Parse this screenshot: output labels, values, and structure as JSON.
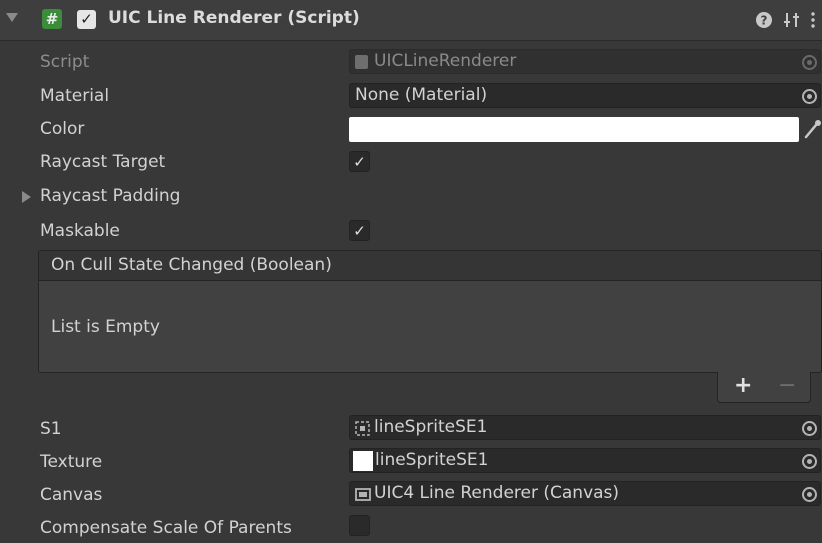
{
  "header": {
    "component_title": "UIC Line Renderer (Script)",
    "enabled_check": "✓",
    "script_icon_glyph": "#",
    "icons": [
      "help-icon",
      "presets-icon",
      "kebab-menu-icon"
    ]
  },
  "rows": {
    "script": {
      "label": "Script",
      "value": "UICLineRenderer"
    },
    "material": {
      "label": "Material",
      "value": "None (Material)"
    },
    "color": {
      "label": "Color",
      "value": "#ffffff"
    },
    "raycast_target": {
      "label": "Raycast Target",
      "check": "✓"
    },
    "raycast_padding": {
      "label": "Raycast Padding"
    },
    "maskable": {
      "label": "Maskable",
      "check": "✓"
    },
    "s1": {
      "label": "S1",
      "value": "lineSpriteSE1"
    },
    "texture": {
      "label": "Texture",
      "value": "lineSpriteSE1"
    },
    "canvas": {
      "label": "Canvas",
      "value": "UIC4 Line Renderer (Canvas)"
    },
    "compensate": {
      "label": "Compensate Scale Of Parents",
      "checked": false
    }
  },
  "event": {
    "title": "On Cull State Changed (Boolean)",
    "empty_text": "List is Empty",
    "add_label": "+",
    "remove_label": "−"
  }
}
